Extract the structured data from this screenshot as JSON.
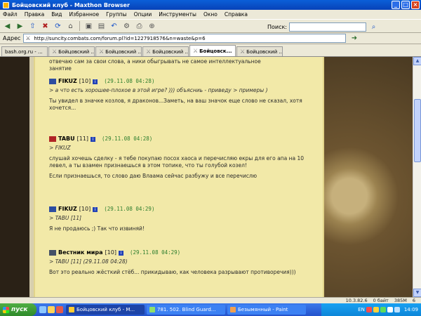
{
  "window": {
    "title": "Бойцовский клуб - Maxthon Browser"
  },
  "menu": [
    "Файл",
    "Правка",
    "Вид",
    "Избранное",
    "Группы",
    "Опции",
    "Инструменты",
    "Окно",
    "Справка"
  ],
  "search": {
    "label": "Поиск:"
  },
  "address": {
    "label": "Адрес",
    "url": "http://suncity.combats.com/forum.pl?id=1227918576&n=waste&p=6"
  },
  "tabs": [
    {
      "label": "bash.org.ru - ..."
    },
    {
      "label": "Бойцовский ..."
    },
    {
      "label": "Бойцовский ..."
    },
    {
      "label": "Бойцовский ..."
    },
    {
      "label": "Бойцовск..."
    },
    {
      "label": "Бойцовский ..."
    }
  ],
  "posts": [
    {
      "author": "FIKUZ",
      "level": "[10]",
      "date": "(29.11.08 04:28)",
      "quote": "> а что есть хорошее-плохое в этой игре? ))) объясниь - приведу > примеры )",
      "text": "Ты увидел в значке козлов, я драконов...Заметь, на ваш значок еще слово не сказал, хотя хочется..."
    },
    {
      "author": "TABU",
      "level": "[11]",
      "date": "(29.11.08 04:28)",
      "quote": "> FIKUZ",
      "text": "слушай хочешь сделку - я тебе покупаю посох хаоса и перечисляю екры для его апа на 10 левел, а ты взамен признаешься в этом топике, что ты голубой козел!",
      "text2": "Если признаешься, то слово даю Влаама сейчас разбужу и все перечислю"
    },
    {
      "author": "FIKUZ",
      "level": "[10]",
      "date": "(29.11.08 04:29)",
      "quote": "> TABU [11]",
      "text": "Я не продаюсь ;) Так что извиняй!"
    },
    {
      "author": "Вестник мира",
      "level": "[10]",
      "date": "(29.11.08 04:29)",
      "quote": "> TABU [11]  (29.11.08 04:28)",
      "text": "Вот это реально жёсткий стёб... прикидываю, как человека разрывают противоречия)))"
    }
  ],
  "top_fragment": {
    "line1": "отвечаю сам за свои слова, а ники обыгрывать не самое интеллектуальное",
    "line2": "занятие"
  },
  "status": {
    "ip": "10.3.82.6",
    "bytes": "0 байт",
    "mem": "385M",
    "num": "6"
  },
  "taskbar": {
    "start": "пуск",
    "buttons": [
      {
        "label": "Бойцовский клуб - M..."
      },
      {
        "label": "781. 502. Blind Guard..."
      },
      {
        "label": "Безымянный - Paint"
      }
    ],
    "lang": "EN",
    "clock": "14:09"
  }
}
